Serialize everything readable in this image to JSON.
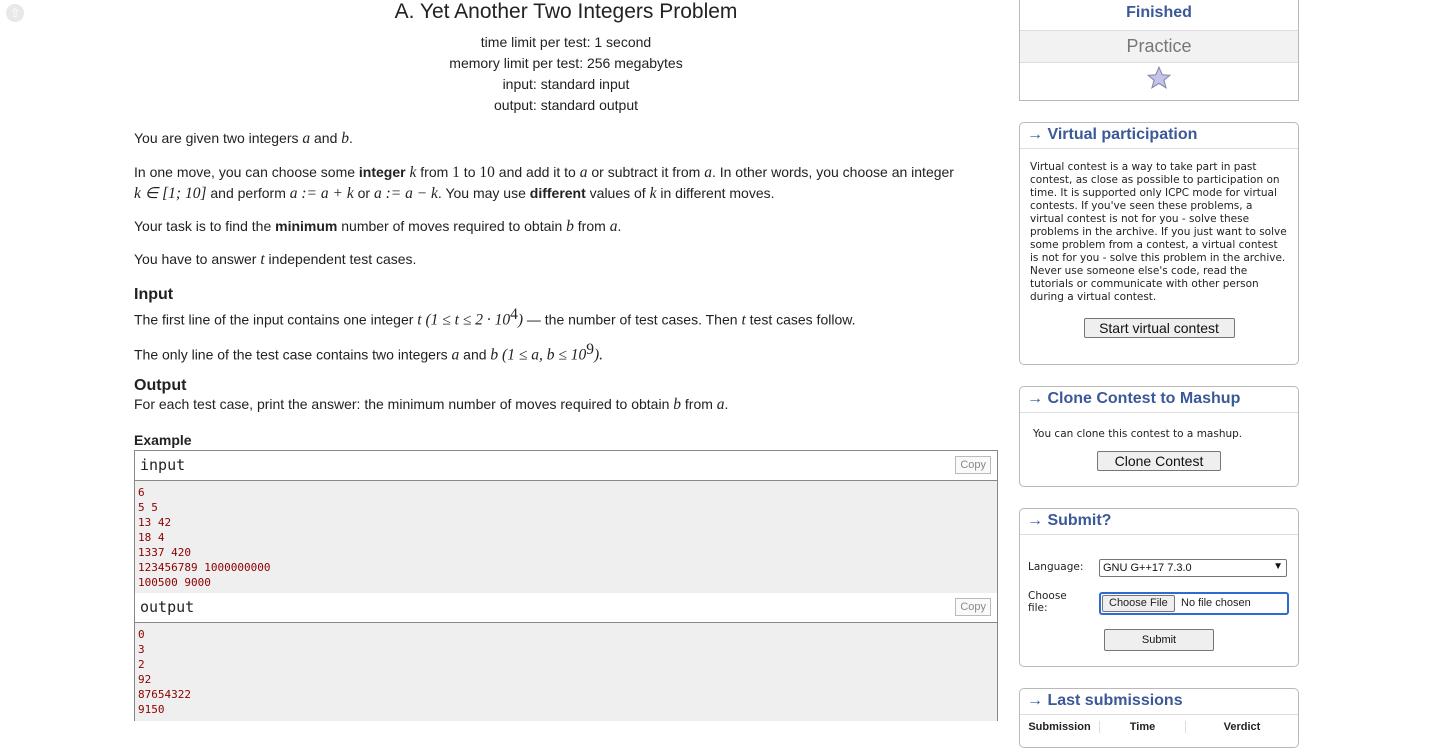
{
  "problem": {
    "title": "A. Yet Another Two Integers Problem",
    "time_limit": "time limit per test: 1 second",
    "memory_limit": "memory limit per test: 256 megabytes",
    "input_file": "input: standard input",
    "output_file": "output: standard output",
    "p1": {
      "a": "You are given two integers ",
      "v1": "a",
      "b": " and ",
      "v2": "b",
      "c": "."
    },
    "p2": {
      "t1": "In one move, you can choose some ",
      "bold1": "integer",
      "v_k": "k",
      "t2": " from ",
      "n1": "1",
      "t3": " to ",
      "n10": "10",
      "t4": " and add it to ",
      "v_a": "a",
      "t5": " or subtract it from ",
      "v_a2": "a",
      "t6": ". In other words, you choose an integer",
      "m1": "k ∈ [1; 10]",
      "t7": " and perform ",
      "m2": "a := a + k",
      "t8": " or ",
      "m3": "a := a − k",
      "t9": ". You may use ",
      "bold2": "different",
      "t10": " values of ",
      "v_k2": "k",
      "t11": " in different moves."
    },
    "p3": {
      "a": "Your task is to find the ",
      "bold": "minimum",
      "b": " number of moves required to obtain ",
      "v1": "b",
      "c": " from ",
      "v2": "a",
      "d": "."
    },
    "p4": {
      "a": "You have to answer ",
      "v": "t",
      "b": " independent test cases."
    },
    "input_title": "Input",
    "input_p1": {
      "a": "The first line of the input contains one integer ",
      "v": "t",
      "m": "(1 ≤ t ≤ 2 · 10",
      "exp": "4",
      "m_end": ")",
      "b": " — the number of test cases. Then ",
      "v2": "t",
      "c": " test cases follow."
    },
    "input_p2": {
      "a": "The only line of the test case contains two integers ",
      "v1": "a",
      "b": " and ",
      "v2": "b",
      "m": "(1 ≤ a, b ≤ 10",
      "exp": "9",
      "m_end": ").",
      "c": ""
    },
    "output_title": "Output",
    "output_p": {
      "a": "For each test case, print the answer: the minimum number of moves required to obtain ",
      "v1": "b",
      "b": " from ",
      "v2": "a",
      "c": "."
    },
    "example_title": "Example",
    "copy_label": "Copy",
    "input_label": "input",
    "output_label": "output",
    "input_lines": [
      "6",
      "5 5",
      "13 42",
      "18 4",
      "1337 420",
      "123456789 1000000000",
      "100500 9000"
    ],
    "output_lines": [
      "0",
      "3",
      "2",
      "92",
      "87654322",
      "9150"
    ]
  },
  "sidebar": {
    "status": "Finished",
    "mode": "Practice",
    "virtual": {
      "title": "Virtual participation",
      "text": "Virtual contest is a way to take part in past contest, as close as possible to participation on time. It is supported only ICPC mode for virtual contests. If you've seen these problems, a virtual contest is not for you - solve these problems in the archive. If you just want to solve some problem from a contest, a virtual contest is not for you - solve this problem in the archive. Never use someone else's code, read the tutorials or communicate with other person during a virtual contest.",
      "button": "Start virtual contest"
    },
    "clone": {
      "title": "Clone Contest to Mashup",
      "text": "You can clone this contest to a mashup.",
      "button": "Clone Contest"
    },
    "submit": {
      "title": "Submit?",
      "language_label": "Language:",
      "language_value": "GNU G++17 7.3.0",
      "file_label": "Choose file:",
      "choose_button": "Choose File",
      "no_file": "No file chosen",
      "submit_button": "Submit"
    },
    "last": {
      "title": "Last submissions",
      "columns": [
        "Submission",
        "Time",
        "Verdict"
      ]
    },
    "arrow": "→"
  }
}
